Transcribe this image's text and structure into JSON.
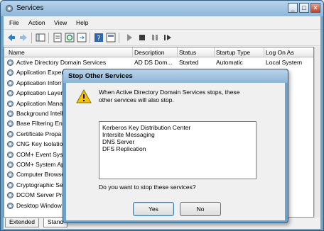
{
  "window": {
    "title": "Services"
  },
  "menu": [
    "File",
    "Action",
    "View",
    "Help"
  ],
  "columns": [
    "Name",
    "Description",
    "Status",
    "Startup Type",
    "Log On As"
  ],
  "rows": [
    {
      "name": "Active Directory Domain Services",
      "desc": "AD DS Dom...",
      "status": "Started",
      "startup": "Automatic",
      "logon": "Local System"
    },
    {
      "name": "Application Exper",
      "logon": "rstem"
    },
    {
      "name": "Application Inforr",
      "logon": "rstem"
    },
    {
      "name": "Application Layer",
      "logon": "rvice"
    },
    {
      "name": "Application Mana",
      "logon": "rstem"
    },
    {
      "name": "Background Intell",
      "logon": "rstem"
    },
    {
      "name": "Base Filtering Eng",
      "logon": "rvice"
    },
    {
      "name": "Certificate Propa",
      "logon": "rstem"
    },
    {
      "name": "CNG Key Isolation",
      "logon": "rstem"
    },
    {
      "name": "COM+ Event Syst",
      "logon": "rvice"
    },
    {
      "name": "COM+ System Ap",
      "logon": "rstem"
    },
    {
      "name": "Computer Browse",
      "logon": "rstem"
    },
    {
      "name": "Cryptographic Se",
      "logon": "rvice"
    },
    {
      "name": "DCOM Server Pro",
      "logon": "rstem"
    },
    {
      "name": "Desktop Window",
      "logon": "rstem"
    }
  ],
  "tabs": [
    "Extended",
    "Stand"
  ],
  "dialog": {
    "title": "Stop Other Services",
    "message_line1": "When Active Directory Domain Services stops, these",
    "message_line2": "other services will also stop.",
    "services": [
      "Kerberos Key Distribution Center",
      "Intersite Messaging",
      "DNS Server",
      "DFS Replication"
    ],
    "question": "Do you want to stop these services?",
    "yes": "Yes",
    "no": "No"
  }
}
